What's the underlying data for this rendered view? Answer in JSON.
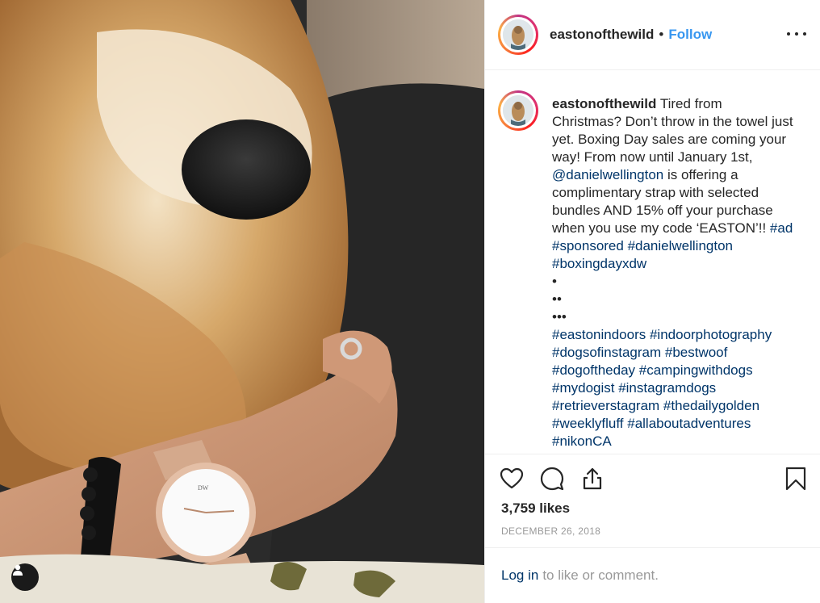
{
  "post": {
    "username": "eastonofthewild",
    "separator": "•",
    "follow_label": "Follow",
    "more_icon": "more-options-icon",
    "caption": {
      "username": "eastonofthewild",
      "text_1": " Tired from Christmas? Don’t throw in the towel just yet. Boxing Day sales are coming your way! From now until January 1st, ",
      "mention": "@danielwellington",
      "text_2": " is offering a complimentary strap with selected bundles AND 15% off your purchase when you use my code ‘EASTON’!! ",
      "hashtags_1": "#ad #sponsored #danielwellington #boxingdayxdw",
      "dots": "\n•\n••\n•••\n",
      "hashtags_2": "#eastonindoors #indoorphotography #dogsofinstagram #bestwoof #dogoftheday #campingwithdogs #mydogist #instagramdogs #retrieverstagram #thedailygolden #weeklyfluff #allaboutadventures #nikonCA"
    },
    "likes": "3,759 likes",
    "date": "DECEMBER 26, 2018",
    "footer": {
      "login_label": "Log in",
      "rest": "to like or comment."
    }
  },
  "colors": {
    "link": "#003569",
    "follow": "#3897f0",
    "muted": "#999999",
    "border": "#efefef"
  }
}
